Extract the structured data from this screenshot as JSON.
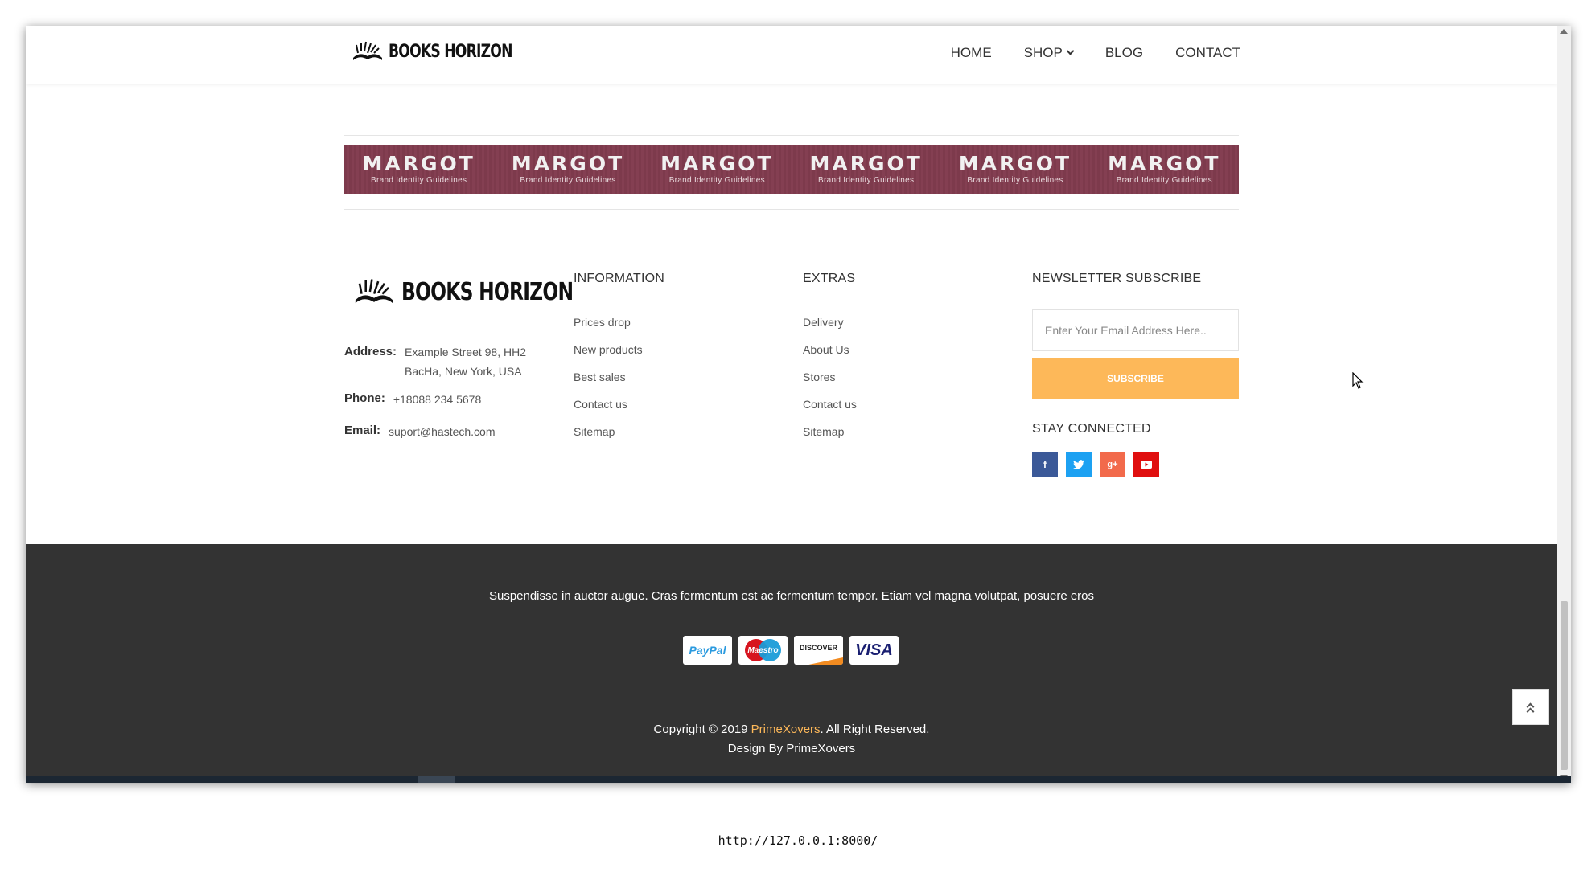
{
  "header": {
    "logo_text": "BOOKS HORIZON",
    "nav": [
      "HOME",
      "SHOP",
      "BLOG",
      "CONTACT"
    ]
  },
  "brands": [
    {
      "name": "MARGOT",
      "sub": "Brand Identity Guidelines"
    },
    {
      "name": "MARGOT",
      "sub": "Brand Identity Guidelines"
    },
    {
      "name": "MARGOT",
      "sub": "Brand Identity Guidelines"
    },
    {
      "name": "MARGOT",
      "sub": "Brand Identity Guidelines"
    },
    {
      "name": "MARGOT",
      "sub": "Brand Identity Guidelines"
    },
    {
      "name": "MARGOT",
      "sub": "Brand Identity Guidelines"
    }
  ],
  "footer": {
    "logo_text": "BOOKS HORIZON",
    "address_label": "Address:",
    "address_line1": "Example Street 98, HH2",
    "address_line2": "BacHa, New York, USA",
    "phone_label": "Phone:",
    "phone": "+18088 234 5678",
    "email_label": "Email:",
    "email": "suport@hastech.com",
    "information": {
      "title": "INFORMATION",
      "items": [
        "Prices drop",
        "New products",
        "Best sales",
        "Contact us",
        "Sitemap"
      ]
    },
    "extras": {
      "title": "EXTRAS",
      "items": [
        "Delivery",
        "About Us",
        "Stores",
        "Contact us",
        "Sitemap"
      ]
    },
    "newsletter": {
      "title": "NEWSLETTER SUBSCRIBE",
      "placeholder": "Enter Your Email Address Here..",
      "button": "SUBSCRIBE"
    },
    "stay_connected": "STAY CONNECTED",
    "social": [
      {
        "icon": "facebook-icon",
        "glyph": "f",
        "color": "#3b5998"
      },
      {
        "icon": "twitter-icon",
        "glyph": "t",
        "color": "#1da1f2"
      },
      {
        "icon": "google-plus-icon",
        "glyph": "g+",
        "color": "#f26a4b"
      },
      {
        "icon": "youtube-icon",
        "glyph": "▶",
        "color": "#e00f0f"
      }
    ]
  },
  "bottom": {
    "tagline": "Suspendisse in auctor augue. Cras fermentum est ac fermentum tempor. Etiam vel magna volutpat, posuere eros",
    "payments": [
      "PayPal",
      "Maestro",
      "DISCOVER",
      "VISA"
    ],
    "copyright_prefix": "Copyright © 2019 ",
    "copyright_brand": "PrimeXovers",
    "copyright_suffix": ". All Right Reserved.",
    "design_by": "Design By PrimeXovers"
  },
  "url": "http://127.0.0.1:8000/",
  "colors": {
    "accent": "#fdb859",
    "dark_footer": "#333333",
    "brand_strip": "#7d3a4c"
  }
}
